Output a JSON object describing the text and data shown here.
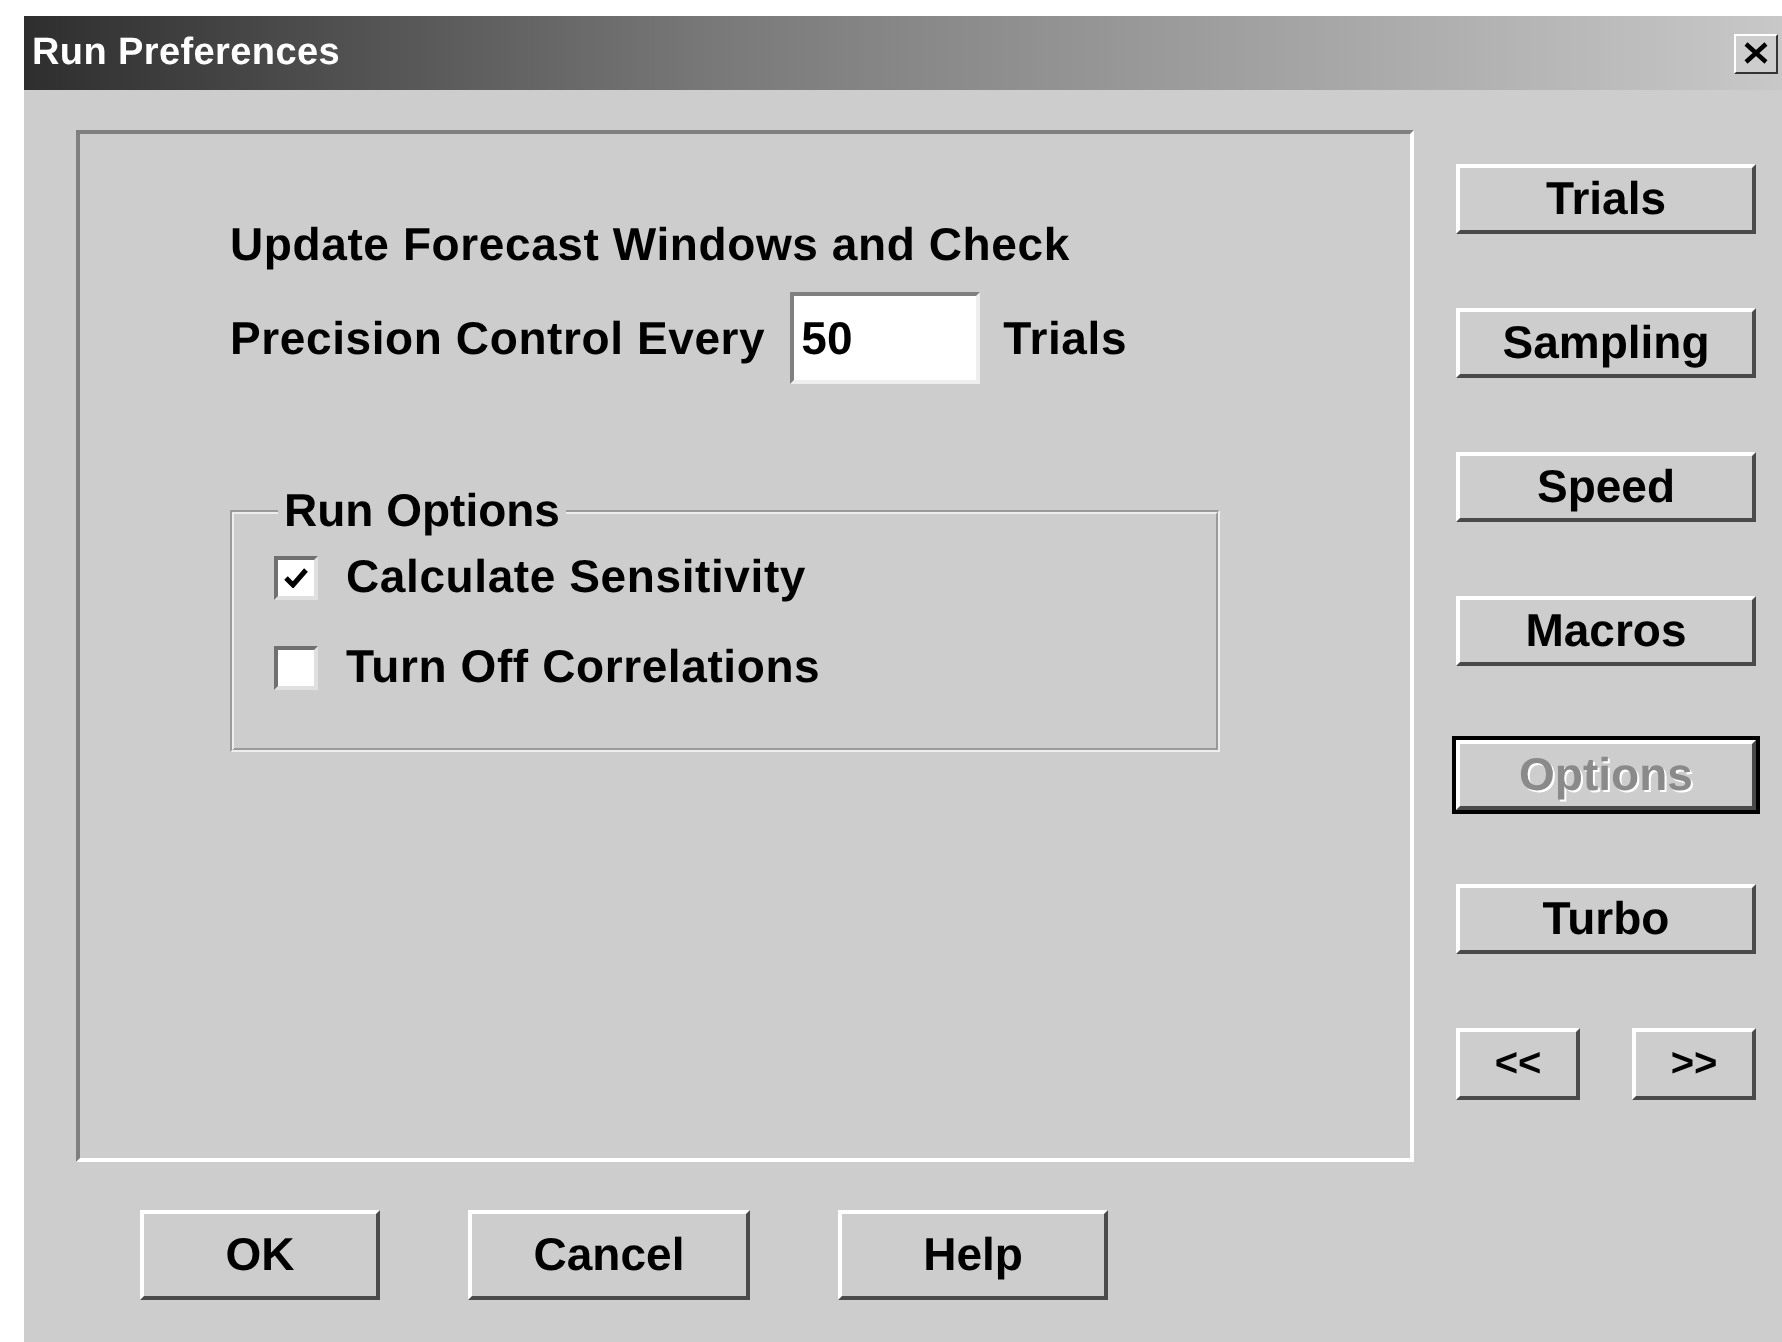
{
  "window": {
    "title": "Run Preferences"
  },
  "prompt": {
    "line_1": "Update Forecast Windows and Check",
    "line_2": "Precision Control Every",
    "value": "50",
    "unit": "Trials"
  },
  "run_options": {
    "title": "Run Options",
    "checkboxes": [
      {
        "label": "Calculate Sensitivity",
        "checked": true
      },
      {
        "label": "Turn Off Correlations",
        "checked": false
      }
    ]
  },
  "side_buttons": [
    {
      "label": "Trials",
      "disabled": false,
      "focused": false
    },
    {
      "label": "Sampling",
      "disabled": false,
      "focused": false
    },
    {
      "label": "Speed",
      "disabled": false,
      "focused": false
    },
    {
      "label": "Macros",
      "disabled": false,
      "focused": false
    },
    {
      "label": "Options",
      "disabled": true,
      "focused": true
    },
    {
      "label": "Turbo",
      "disabled": false,
      "focused": false
    }
  ],
  "nav_buttons": [
    "<<",
    ">>"
  ],
  "buttons": [
    "OK",
    "Cancel",
    "Help"
  ]
}
